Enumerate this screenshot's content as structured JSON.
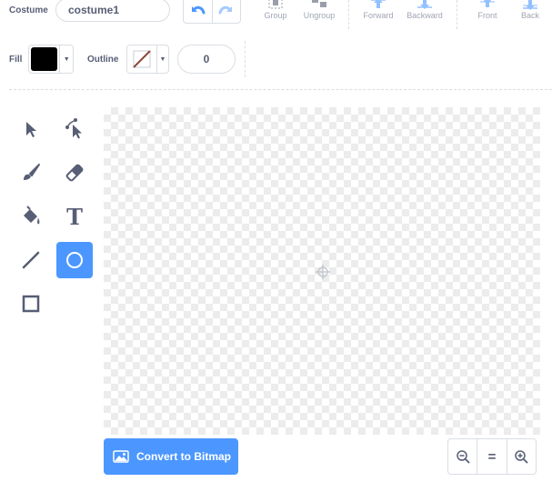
{
  "costume": {
    "label": "Costume",
    "name_value": "costume1"
  },
  "toolbar": {
    "group": "Group",
    "ungroup": "Ungroup",
    "forward": "Forward",
    "backward": "Backward",
    "front": "Front",
    "back": "Back"
  },
  "fill": {
    "label": "Fill",
    "color": "#000000"
  },
  "outline": {
    "label": "Outline",
    "width": "0"
  },
  "tools": [
    {
      "id": "select",
      "icon": "select-icon"
    },
    {
      "id": "reshape",
      "icon": "reshape-icon"
    },
    {
      "id": "brush",
      "icon": "brush-icon"
    },
    {
      "id": "eraser",
      "icon": "eraser-icon"
    },
    {
      "id": "fill",
      "icon": "paint-bucket-icon"
    },
    {
      "id": "text",
      "icon": "text-icon",
      "glyph": "T"
    },
    {
      "id": "line",
      "icon": "line-icon"
    },
    {
      "id": "circle",
      "icon": "circle-icon",
      "selected": true
    },
    {
      "id": "rectangle",
      "icon": "rectangle-icon"
    }
  ],
  "bottom": {
    "convert_label": "Convert to Bitmap",
    "zoom_reset_glyph": "="
  },
  "colors": {
    "accent": "#4c97ff",
    "text": "#575e75",
    "border": "#d9dde4"
  }
}
